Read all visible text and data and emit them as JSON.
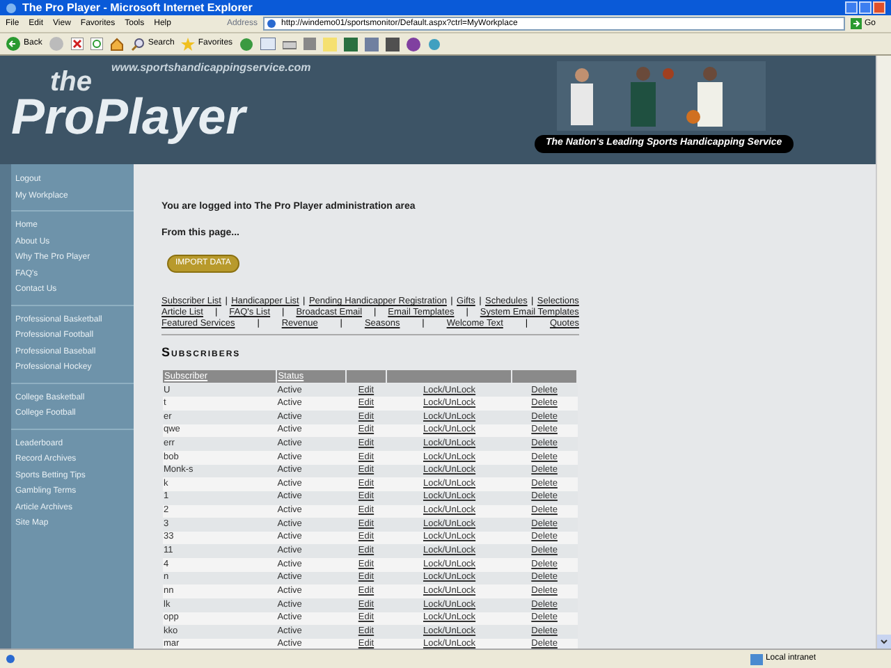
{
  "window": {
    "title": "The Pro Player - Microsoft Internet Explorer"
  },
  "menu": [
    "File",
    "Edit",
    "View",
    "Favorites",
    "Tools",
    "Help"
  ],
  "toolbar": {
    "back": "Back",
    "search": "Search",
    "favorites": "Favorites"
  },
  "address": {
    "label": "Address",
    "url": "http://windemo01/sportsmonitor/Default.aspx?ctrl=MyWorkplace",
    "go": "Go"
  },
  "banner": {
    "site_url": "www.sportshandicappingservice.com",
    "logo_small": "the",
    "logo": "ProPlayer",
    "tagline": "The Nation's Leading Sports Handicapping Service"
  },
  "sidebar": [
    [
      "Logout",
      "My Workplace"
    ],
    [
      "Home",
      "About Us",
      "Why The Pro Player",
      "FAQ's",
      "Contact Us"
    ],
    [
      "Professional Basketball",
      "Professional Football",
      "Professional Baseball",
      "Professional Hockey"
    ],
    [
      "College Basketball",
      "College Football"
    ],
    [
      "Leaderboard",
      "Record Archives",
      "Sports Betting Tips",
      "Gambling Terms",
      "Article Archives",
      "Site Map"
    ]
  ],
  "intro": "You are logged into The Pro Player administration area",
  "from": "From this page...",
  "import_button": "IMPORT DATA",
  "links": [
    [
      "Subscriber List",
      "Handicapper List",
      "Pending Handicapper Registration",
      "Gifts",
      "Schedules",
      "Selections"
    ],
    [
      "Article List",
      "FAQ's List",
      "Broadcast Email",
      "Email Templates",
      "System Email Templates"
    ],
    [
      "Featured Services",
      "Revenue",
      "Seasons",
      "Welcome Text",
      "Quotes"
    ]
  ],
  "link_separator": "|",
  "section_title": "Subscribers",
  "table": {
    "columns": [
      "Subscriber",
      "Status"
    ],
    "rows": [
      [
        "U",
        "Active",
        "Edit",
        "Lock/UnLock",
        "Delete"
      ],
      [
        "t",
        "Active",
        "Edit",
        "Lock/UnLock",
        "Delete"
      ],
      [
        "er",
        "Active",
        "Edit",
        "Lock/UnLock",
        "Delete"
      ],
      [
        "qwe",
        "Active",
        "Edit",
        "Lock/UnLock",
        "Delete"
      ],
      [
        "err",
        "Active",
        "Edit",
        "Lock/UnLock",
        "Delete"
      ],
      [
        "bob",
        "Active",
        "Edit",
        "Lock/UnLock",
        "Delete"
      ],
      [
        "Monk-s",
        "Active",
        "Edit",
        "Lock/UnLock",
        "Delete"
      ],
      [
        "k",
        "Active",
        "Edit",
        "Lock/UnLock",
        "Delete"
      ],
      [
        "1",
        "Active",
        "Edit",
        "Lock/UnLock",
        "Delete"
      ],
      [
        "2",
        "Active",
        "Edit",
        "Lock/UnLock",
        "Delete"
      ],
      [
        "3",
        "Active",
        "Edit",
        "Lock/UnLock",
        "Delete"
      ],
      [
        "33",
        "Active",
        "Edit",
        "Lock/UnLock",
        "Delete"
      ],
      [
        "11",
        "Active",
        "Edit",
        "Lock/UnLock",
        "Delete"
      ],
      [
        "4",
        "Active",
        "Edit",
        "Lock/UnLock",
        "Delete"
      ],
      [
        "n",
        "Active",
        "Edit",
        "Lock/UnLock",
        "Delete"
      ],
      [
        "nn",
        "Active",
        "Edit",
        "Lock/UnLock",
        "Delete"
      ],
      [
        "lk",
        "Active",
        "Edit",
        "Lock/UnLock",
        "Delete"
      ],
      [
        "opp",
        "Active",
        "Edit",
        "Lock/UnLock",
        "Delete"
      ],
      [
        "kko",
        "Active",
        "Edit",
        "Lock/UnLock",
        "Delete"
      ],
      [
        "mar",
        "Active",
        "Edit",
        "Lock/UnLock",
        "Delete"
      ]
    ]
  },
  "status_bar": {
    "zone": "Local intranet"
  }
}
